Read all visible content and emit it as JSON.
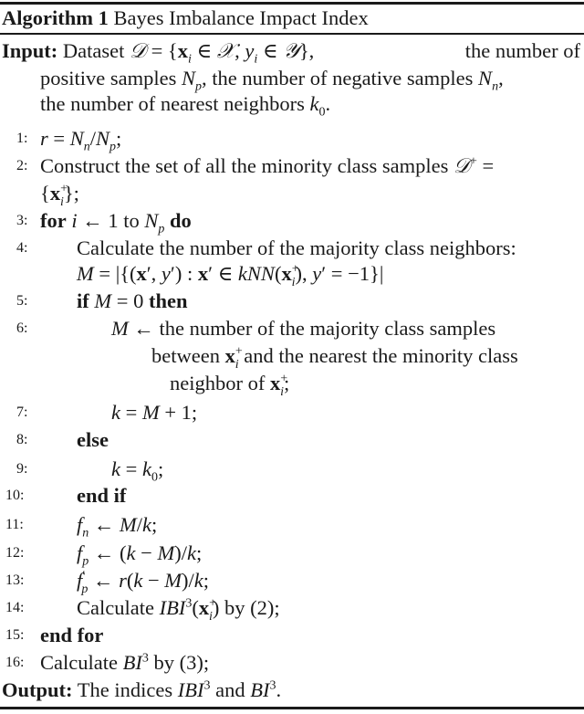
{
  "algorithm": {
    "label": "Algorithm 1",
    "title": "Bayes Imbalance Impact Index"
  },
  "input": {
    "label": "Input:",
    "lines": [
      "Dataset 𝒟 = {xᵢ ∈ 𝒳, yᵢ ∈ 𝒴}, the number of",
      "positive samples Nₚ, the number of negative samples Nₙ,",
      "the number of nearest neighbors k₀."
    ]
  },
  "steps": [
    {
      "num": "1:",
      "text": "r = Nₙ/Nₚ;"
    },
    {
      "num": "2:",
      "text": "Construct the set of all the minority class samples 𝒟⁺ = {xᵢ⁺};"
    },
    {
      "num": "3:",
      "text": "for i ← 1 to Nₚ do"
    },
    {
      "num": "4:",
      "text": "Calculate the number of the majority class neighbors: M = |{(x′, y′) : x′ ∈ kNN(xᵢ⁺), y′ = −1}|"
    },
    {
      "num": "5:",
      "text": "if M = 0 then"
    },
    {
      "num": "6:",
      "text": "M ← the number of the majority class samples between xᵢ⁺ and the nearest the minority class neighbor of xᵢ⁺;"
    },
    {
      "num": "7:",
      "text": "k = M + 1;"
    },
    {
      "num": "8:",
      "text": "else"
    },
    {
      "num": "9:",
      "text": "k = k₀;"
    },
    {
      "num": "10:",
      "text": "end if"
    },
    {
      "num": "11:",
      "text": "fₙ ← M/k;"
    },
    {
      "num": "12:",
      "text": "fₚ ← (k − M)/k;"
    },
    {
      "num": "13:",
      "text": "f′ₚ ← r(k − M)/k;"
    },
    {
      "num": "14:",
      "text": "Calculate IBI³(xᵢ⁺) by (2);"
    },
    {
      "num": "15:",
      "text": "end for"
    },
    {
      "num": "16:",
      "text": "Calculate BI³ by (3);"
    }
  ],
  "output": {
    "label": "Output:",
    "text": "The indices IBI³ and BI³."
  },
  "words": {
    "dataset": "Dataset",
    "the_number_of": "the number of",
    "positive_samples": "positive samples",
    "the_number_of_negative_samples": ", the number of negative samples",
    "nearest_neighbors": "the number of nearest neighbors",
    "construct": "Construct the set of all the minority class samples",
    "for": "for",
    "to": "to",
    "do": "do",
    "calc_neighbors": "Calculate the number of the majority class neighbors:",
    "if": "if",
    "then": "then",
    "majority_samples": "the number of the majority class samples",
    "between": "between",
    "nearest_minority": "and the nearest the minority class",
    "neighbor_of": "neighbor of",
    "else": "else",
    "end_if": "end if",
    "calculate": "Calculate",
    "by_2": "by (2);",
    "end_for": "end for",
    "by_3": "by (3);",
    "the_indices": "The indices",
    "and": "and"
  }
}
